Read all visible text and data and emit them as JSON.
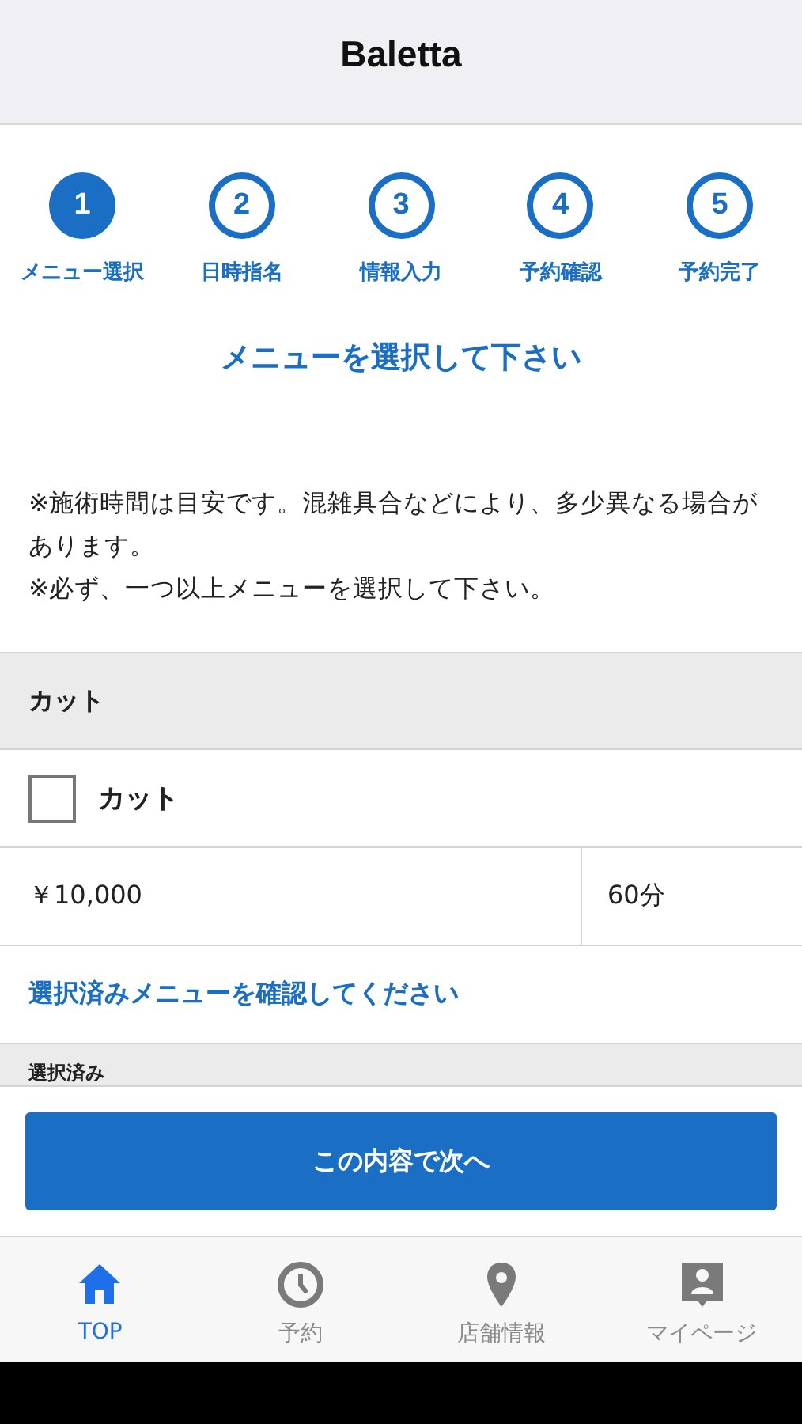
{
  "header": {
    "title": "Baletta"
  },
  "steps": [
    {
      "number": "1",
      "label": "メニュー選択",
      "selected": true
    },
    {
      "number": "2",
      "label": "日時指名",
      "selected": false
    },
    {
      "number": "3",
      "label": "情報入力",
      "selected": false
    },
    {
      "number": "4",
      "label": "予約確認",
      "selected": false
    },
    {
      "number": "5",
      "label": "予約完了",
      "selected": false
    }
  ],
  "heading": "メニューを選択して下さい",
  "notes": [
    "※施術時間は目安です。混雑具合などにより、多少異なる場合があります。",
    "※必ず、一つ以上メニューを選択して下さい。"
  ],
  "category": {
    "title": "カット",
    "items": [
      {
        "name": "カット",
        "checked": false,
        "price": "￥10,000",
        "duration": "60分"
      }
    ]
  },
  "confirm_link": "選択済みメニューを確認してください",
  "selected_section": {
    "title": "選択済み"
  },
  "next_button": "この内容で次へ",
  "tab_bar": [
    {
      "label": "TOP",
      "kind": "home",
      "selected": true
    },
    {
      "label": "予約",
      "kind": "clock",
      "selected": false
    },
    {
      "label": "店舗情報",
      "kind": "pin",
      "selected": false
    },
    {
      "label": "マイページ",
      "kind": "user",
      "selected": false
    }
  ]
}
